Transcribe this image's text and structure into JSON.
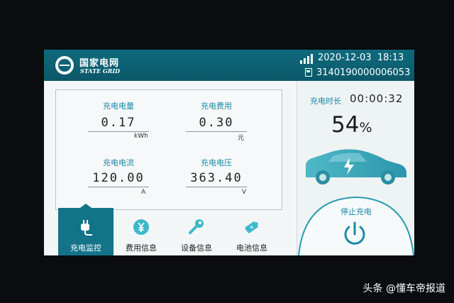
{
  "header": {
    "brand_cn": "国家电网",
    "brand_en": "STATE GRID",
    "datetime": "2020-12-03  18:13",
    "device_id": "3140190000006053",
    "accent_color": "#0d6276"
  },
  "metrics": [
    {
      "label": "充电电量",
      "value": "0.17",
      "unit": "kWh"
    },
    {
      "label": "充电费用",
      "value": "0.30",
      "unit": "元"
    },
    {
      "label": "充电电流",
      "value": "120.00",
      "unit": "A"
    },
    {
      "label": "充电电压",
      "value": "363.40",
      "unit": "V"
    }
  ],
  "menu": [
    {
      "label": "充电监控",
      "icon": "plug-icon",
      "active": true
    },
    {
      "label": "费用信息",
      "icon": "yuan-coin-icon",
      "active": false
    },
    {
      "label": "设备信息",
      "icon": "wrench-icon",
      "active": false
    },
    {
      "label": "电池信息",
      "icon": "battery-icon",
      "active": false
    }
  ],
  "charging": {
    "time_label": "充电时长",
    "duration": "00:00:32",
    "percent_value": "54",
    "percent_sign": "%",
    "stop_label": "停止充电"
  },
  "watermark": "头条 @懂车帝报道"
}
